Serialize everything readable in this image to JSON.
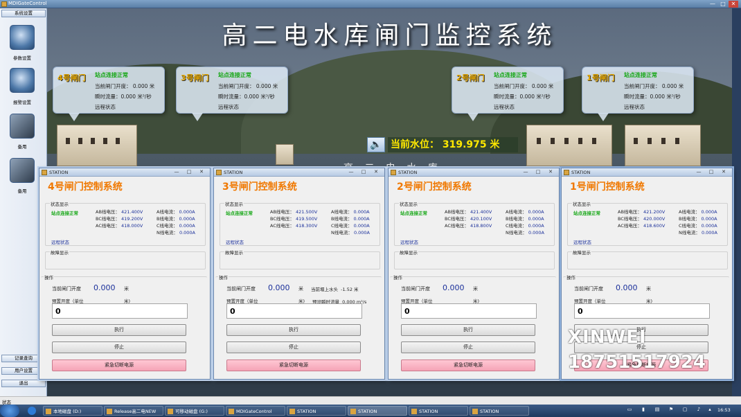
{
  "window": {
    "title": "MDIGateControl",
    "min": "—",
    "max": "□",
    "close": "✕"
  },
  "sidebar": {
    "top_button": "系统设置",
    "items": [
      {
        "label": "参数设置",
        "icon": "gear-icon"
      },
      {
        "label": "报警设置",
        "icon": "alarm-gear-icon"
      },
      {
        "label": "备用",
        "icon": "tablet-icon"
      },
      {
        "label": "备用",
        "icon": "tablet-icon"
      }
    ],
    "bottom_buttons": [
      "记录查询",
      "用户设置",
      "退出"
    ]
  },
  "hero": {
    "title": "高二电水库闸门监控系统",
    "water_level_label": "当前水位：",
    "water_level_value": "319.975",
    "water_level_unit": "米",
    "building_sign": "高  二  电  水  库",
    "bubbles": [
      {
        "gate": "4号闸门",
        "status": "站点连接正常",
        "opening_label": "当前闸门开度：",
        "opening": "0.000 米",
        "flow_label": "瞬时流量：",
        "flow": "0.000 米³/秒",
        "remote": "远程状态"
      },
      {
        "gate": "3号闸门",
        "status": "站点连接正常",
        "opening_label": "当前闸门开度：",
        "opening": "0.000 米",
        "flow_label": "瞬时流量：",
        "flow": "0.000 米³/秒",
        "remote": "远程状态"
      },
      {
        "gate": "2号闸门",
        "status": "站点连接正常",
        "opening_label": "当前闸门开度：",
        "opening": "0.000 米",
        "flow_label": "瞬时流量：",
        "flow": "0.000 米³/秒",
        "remote": "远程状态"
      },
      {
        "gate": "1号闸门",
        "status": "站点连接正常",
        "opening_label": "当前闸门开度：",
        "opening": "0.000 米",
        "flow_label": "瞬时流量：",
        "flow": "0.000 米³/秒",
        "remote": "远程状态"
      }
    ]
  },
  "panels": [
    {
      "window_title": "STATION",
      "heading": "4号闸门控制系统",
      "status_group": "状态显示",
      "conn": "站点连接正常",
      "voltages": [
        [
          "AB线电压：",
          "421.400V"
        ],
        [
          "BC线电压：",
          "419.200V"
        ],
        [
          "AC线电压：",
          "418.000V"
        ]
      ],
      "currents": [
        [
          "A线电流：",
          "0.000A"
        ],
        [
          "B线电流：",
          "0.000A"
        ],
        [
          "C线电流：",
          "0.000A"
        ],
        [
          "N线电流：",
          "0.000A"
        ]
      ],
      "remote": "远程状态",
      "fault_group": "故障显示",
      "op_group": "操作",
      "opening_label": "当前闸门开度",
      "opening_value": "0.000",
      "opening_unit": "米",
      "preset_label": "预置开度（单位",
      "preset_unit": "米)",
      "input_value": "0",
      "extra": null,
      "btn_exec": "执行",
      "btn_stop": "停止",
      "btn_estop": "紧急切断电源"
    },
    {
      "window_title": "STATION",
      "heading": "3号闸门控制系统",
      "status_group": "状态显示",
      "conn": "站点连接正常",
      "voltages": [
        [
          "AB线电压：",
          "421.500V"
        ],
        [
          "BC线电压：",
          "419.500V"
        ],
        [
          "AC线电压：",
          "418.300V"
        ]
      ],
      "currents": [
        [
          "A线电流：",
          "0.000A"
        ],
        [
          "B线电流：",
          "0.000A"
        ],
        [
          "C线电流：",
          "0.000A"
        ],
        [
          "N线电流：",
          "0.000A"
        ]
      ],
      "remote": "远程状态",
      "fault_group": "故障显示",
      "op_group": "操作",
      "opening_label": "当前闸门开度",
      "opening_value": "0.000",
      "opening_unit": "米",
      "preset_label": "预置开度（单位",
      "preset_unit": "米)",
      "input_value": "0",
      "extra": {
        "head_label": "当前堰上水头",
        "head_value": "-1.52 米",
        "flow_label": "预设瞬时流量",
        "flow_value": "0.000 m³/s"
      },
      "btn_exec": "执行",
      "btn_stop": "停止",
      "btn_estop": "紧急切断电源"
    },
    {
      "window_title": "STATION",
      "heading": "2号闸门控制系统",
      "status_group": "状态显示",
      "conn": "站点连接正常",
      "voltages": [
        [
          "AB线电压：",
          "421.400V"
        ],
        [
          "BC线电压：",
          "420.100V"
        ],
        [
          "AC线电压：",
          "418.800V"
        ]
      ],
      "currents": [
        [
          "A线电流：",
          "0.000A"
        ],
        [
          "B线电流：",
          "0.000A"
        ],
        [
          "C线电流：",
          "0.000A"
        ],
        [
          "N线电流：",
          "0.000A"
        ]
      ],
      "remote": "远程状态",
      "fault_group": "故障显示",
      "op_group": "操作",
      "opening_label": "当前闸门开度",
      "opening_value": "0.000",
      "opening_unit": "米",
      "preset_label": "预置开度（单位",
      "preset_unit": "米)",
      "input_value": "0",
      "extra": null,
      "btn_exec": "执行",
      "btn_stop": "停止",
      "btn_estop": "紧急切断电源"
    },
    {
      "window_title": "STATION",
      "heading": "1号闸门控制系统",
      "status_group": "状态显示",
      "conn": "站点连接正常",
      "voltages": [
        [
          "AB线电压：",
          "421.200V"
        ],
        [
          "BC线电压：",
          "420.000V"
        ],
        [
          "AC线电压：",
          "418.600V"
        ]
      ],
      "currents": [
        [
          "A线电流：",
          "0.000A"
        ],
        [
          "B线电流：",
          "0.000A"
        ],
        [
          "C线电流：",
          "0.000A"
        ],
        [
          "N线电流：",
          "0.000A"
        ]
      ],
      "remote": "远程状态",
      "fault_group": "故障显示",
      "op_group": "操作",
      "opening_label": "当前闸门开度",
      "opening_value": "0.000",
      "opening_unit": "米",
      "preset_label": "预置开度（单位",
      "preset_unit": "米)",
      "input_value": "0",
      "extra": null,
      "btn_exec": "执行",
      "btn_stop": "停止",
      "btn_estop": "紧急切断电源"
    }
  ],
  "watermark": {
    "line1": "XINWEI",
    "line2": "18751517924"
  },
  "statusbar": {
    "text": "状态"
  },
  "taskbar": {
    "items": [
      {
        "label": "本地磁盘 (D:)"
      },
      {
        "label": "Release高二电NEW"
      },
      {
        "label": "可移动磁盘 (G:)"
      },
      {
        "label": "MDIGateControl"
      },
      {
        "label": "STATION"
      },
      {
        "label": "STATION"
      },
      {
        "label": "STATION"
      },
      {
        "label": "STATION"
      }
    ],
    "clock": "16:53"
  },
  "colors": {
    "heading_orange": "#f07800",
    "status_green": "#16a716",
    "value_blue": "#1a2f9a",
    "level_yellow": "#ffe800",
    "estop_pink": "#f5a3b6"
  }
}
